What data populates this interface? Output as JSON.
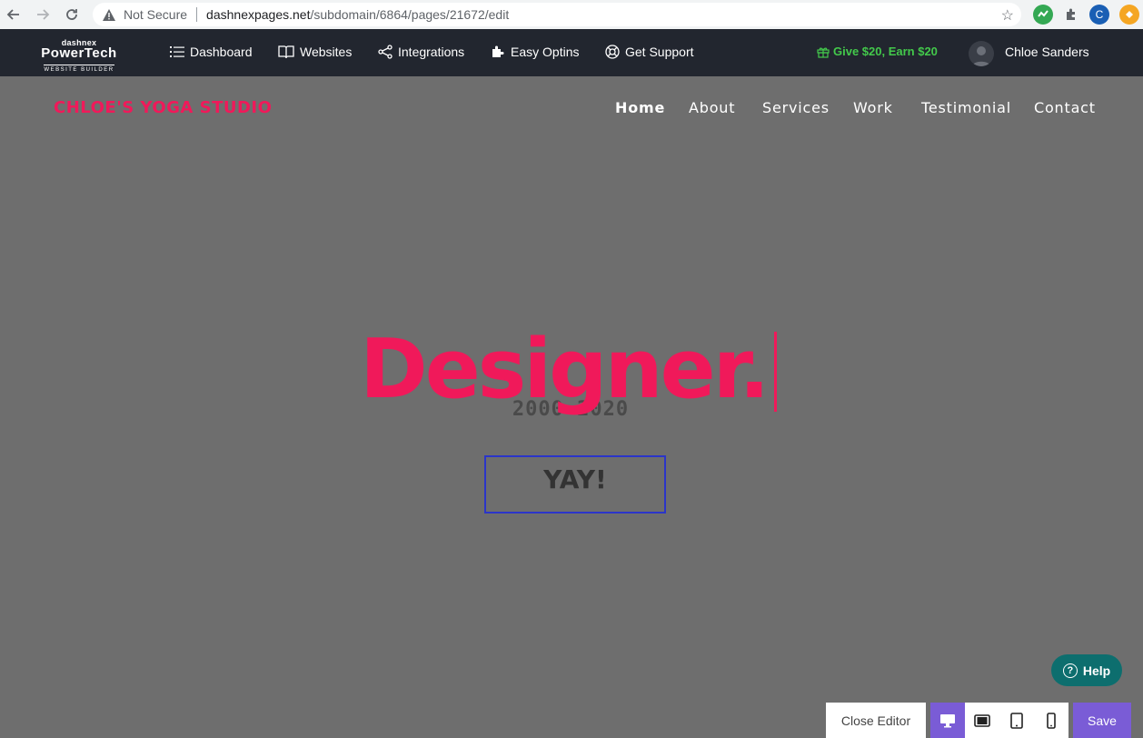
{
  "browser": {
    "security_label": "Not Secure",
    "url_domain": "dashnexpages.net",
    "url_path": "/subdomain/6864/pages/21672/edit",
    "profile_initial": "C"
  },
  "app_header": {
    "logo": {
      "line1": "dashnex",
      "line2": "PowerTech",
      "line3": "WEBSITE BUILDER"
    },
    "menu": [
      {
        "label": "Dashboard",
        "icon": "list-icon"
      },
      {
        "label": "Websites",
        "icon": "book-icon"
      },
      {
        "label": "Integrations",
        "icon": "share-icon"
      },
      {
        "label": "Easy Optins",
        "icon": "puzzle-icon"
      },
      {
        "label": "Get Support",
        "icon": "lifebuoy-icon"
      }
    ],
    "promo": "Give $20, Earn $20",
    "promo_color": "#43c94b",
    "user_name": "Chloe Sanders"
  },
  "site": {
    "logo_text": "CHLOE'S YOGA STUDIO",
    "accent_color": "#f0195a",
    "nav": [
      {
        "label": "Home",
        "active": true
      },
      {
        "label": "About"
      },
      {
        "label": "Services"
      },
      {
        "label": "Work"
      },
      {
        "label": "Testimonial"
      },
      {
        "label": "Contact"
      }
    ],
    "hero_title": "Designer.",
    "hero_subtitle": "2000-2020",
    "button_label": "YAY!"
  },
  "editor": {
    "help_label": "Help",
    "close_label": "Close Editor",
    "save_label": "Save",
    "device_modes": [
      "desktop",
      "tablet-landscape",
      "tablet-portrait",
      "mobile"
    ],
    "active_device": "desktop",
    "accent_color": "#7a5cd6"
  }
}
